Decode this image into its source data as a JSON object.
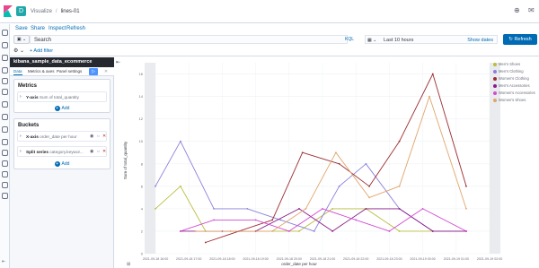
{
  "header": {
    "breadcrumb_1": "Visualize",
    "breadcrumb_2": "lines-01",
    "app_badge": "D"
  },
  "menu": {
    "save": "Save",
    "share": "Share",
    "inspect": "Inspect",
    "refresh": "Refresh"
  },
  "query": {
    "search_label": "Search",
    "language": "KQL",
    "date_range": "Last 10 hours",
    "show_dates": "Show dates",
    "refresh_button": "Refresh"
  },
  "filters": {
    "add_filter": "+ Add filter"
  },
  "editor": {
    "index_pattern": "kibana_sample_data_ecommerce",
    "tabs": [
      "Data",
      "Metrics & axes",
      "Panel settings"
    ],
    "metrics_title": "Metrics",
    "metric_row_label": "Y-axis",
    "metric_row_value": "Sum of total_quantity",
    "buckets_title": "Buckets",
    "bucket_rows": [
      {
        "label": "X-axis",
        "value": "order_date per hour"
      },
      {
        "label": "Split series",
        "value": "category.keywor..."
      }
    ],
    "add_label": "Add"
  },
  "chart_data": {
    "type": "line",
    "title": "",
    "xlabel": "order_date per hour",
    "ylabel": "Sum of total_quantity",
    "ylim": [
      0,
      17
    ],
    "yticks": [
      0,
      2,
      4,
      6,
      8,
      10,
      12,
      14,
      16
    ],
    "x_ticks": [
      "2021-09-18 16:00",
      "2021-09-18 17:00",
      "2021-09-18 18:00",
      "2021-09-18 19:00",
      "2021-09-18 20:00",
      "2021-09-18 21:00",
      "2021-09-18 22:00",
      "2021-09-18 23:00",
      "2021-09-19 00:00",
      "2021-09-19 01:00",
      "2021-09-19 02:00"
    ],
    "grid": true,
    "legend_position": "right",
    "series": [
      {
        "name": "Men's Shoes",
        "color": "#b9be3c",
        "points": [
          [
            0,
            4
          ],
          [
            0.75,
            6
          ],
          [
            1.5,
            2
          ],
          [
            3,
            2
          ],
          [
            4.3,
            2
          ],
          [
            5.3,
            4
          ],
          [
            6.3,
            4
          ],
          [
            7.3,
            2
          ],
          [
            8.3,
            2
          ],
          [
            9.3,
            2
          ]
        ]
      },
      {
        "name": "Men's Clothing",
        "color": "#8b7fd9",
        "points": [
          [
            0,
            6
          ],
          [
            0.75,
            10
          ],
          [
            1.75,
            4
          ],
          [
            2.75,
            4
          ],
          [
            3.75,
            3
          ],
          [
            4.75,
            2
          ],
          [
            5.5,
            6
          ],
          [
            6.3,
            8
          ],
          [
            7.3,
            4
          ],
          [
            8.3,
            2
          ],
          [
            9.3,
            2
          ]
        ]
      },
      {
        "name": "Women's Clothing",
        "color": "#9c2c30",
        "points": [
          [
            1.5,
            1
          ],
          [
            2.5,
            2
          ],
          [
            3.5,
            3
          ],
          [
            4.4,
            9
          ],
          [
            5.5,
            8
          ],
          [
            6.4,
            6
          ],
          [
            7.3,
            10
          ],
          [
            8.3,
            16
          ],
          [
            9.3,
            6
          ]
        ]
      },
      {
        "name": "Men's Accessories",
        "color": "#8a1a8a",
        "points": [
          [
            0.75,
            2
          ],
          [
            2,
            2
          ],
          [
            3,
            2
          ],
          [
            4.3,
            4
          ],
          [
            5.3,
            2
          ],
          [
            6.3,
            4
          ],
          [
            7.3,
            4
          ],
          [
            8.3,
            2
          ],
          [
            9.3,
            2
          ]
        ]
      },
      {
        "name": "Women's Accessories",
        "color": "#d14bd1",
        "points": [
          [
            0.75,
            2
          ],
          [
            1.75,
            3
          ],
          [
            3,
            3
          ],
          [
            4,
            2
          ],
          [
            5,
            4
          ],
          [
            6,
            3
          ],
          [
            7,
            2
          ],
          [
            8,
            4
          ],
          [
            9.3,
            2
          ]
        ]
      },
      {
        "name": "Women's Shoes",
        "color": "#e0a56b",
        "points": [
          [
            1.2,
            2
          ],
          [
            2.25,
            2
          ],
          [
            3.5,
            2
          ],
          [
            4.5,
            4
          ],
          [
            5.4,
            9
          ],
          [
            6.4,
            5
          ],
          [
            7.3,
            6
          ],
          [
            8.2,
            14
          ],
          [
            9.3,
            4
          ]
        ]
      }
    ]
  }
}
